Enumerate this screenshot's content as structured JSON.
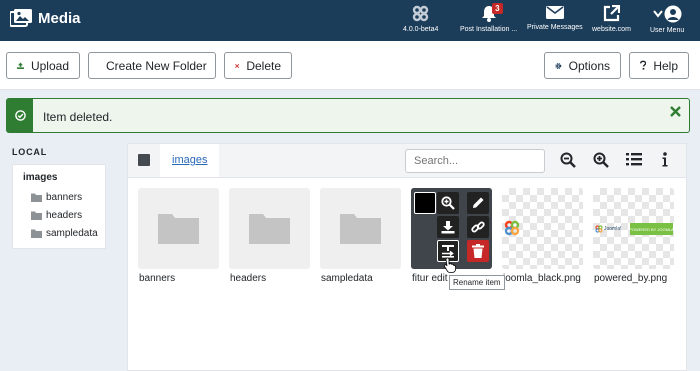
{
  "header": {
    "title": "Media",
    "brand_icon": "images-icon",
    "items": [
      {
        "label": "4.0.0-beta4",
        "icon": "joomla-icon"
      },
      {
        "label": "Post Installation ...",
        "icon": "bell-icon",
        "badge": "3"
      },
      {
        "label": "Private Messages",
        "icon": "envelope-icon"
      },
      {
        "label": "website.com",
        "icon": "external-link-icon"
      },
      {
        "label": "User Menu",
        "icon": "user-icon"
      }
    ]
  },
  "toolbar": {
    "upload": "Upload",
    "new_folder": "Create New Folder",
    "delete": "Delete",
    "options": "Options",
    "help": "Help"
  },
  "alert": {
    "message": "Item deleted.",
    "status_color": "#2f7d32"
  },
  "sidebar": {
    "section": "LOCAL",
    "root": "images",
    "folders": [
      "banners",
      "headers",
      "sampledata"
    ]
  },
  "browser": {
    "breadcrumb": "images",
    "search_placeholder": "Search...",
    "items": [
      {
        "name": "banners",
        "type": "folder"
      },
      {
        "name": "headers",
        "type": "folder"
      },
      {
        "name": "sampledata",
        "type": "folder"
      },
      {
        "name": "fitur edit",
        "type": "image",
        "state": "hover"
      },
      {
        "name": "joomla_black.png",
        "type": "image"
      },
      {
        "name": "powered_by.png",
        "type": "image"
      }
    ],
    "tooltip": "Rename item",
    "powered_text_left": "Joomla!",
    "powered_text_right": "POWERED BY JOOMLA"
  },
  "colors": {
    "header_bg": "#1c3d5a",
    "delete_red": "#c52827",
    "link_blue": "#2a69b8"
  }
}
